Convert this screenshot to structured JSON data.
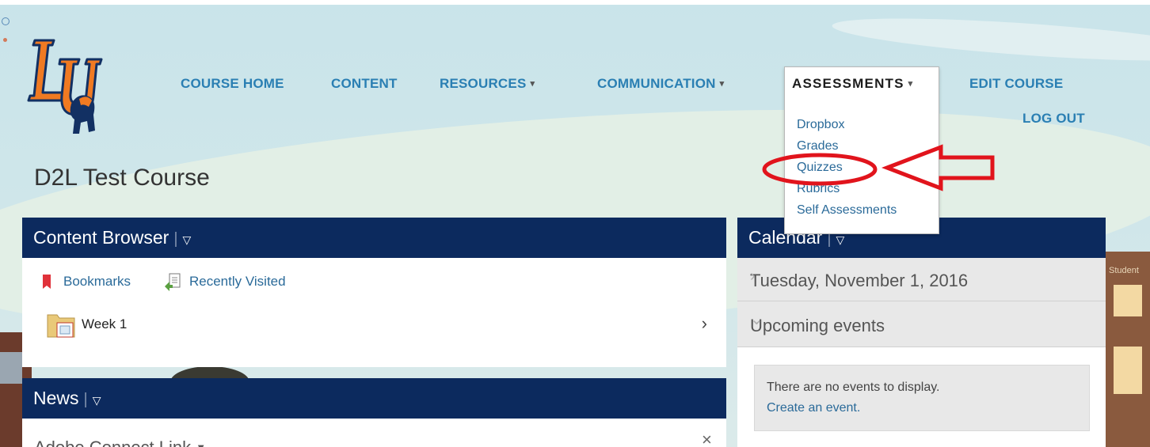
{
  "nav": {
    "course_home": "COURSE HOME",
    "content": "CONTENT",
    "resources": "RESOURCES",
    "communication": "COMMUNICATION",
    "assessments": "ASSESSMENTS",
    "edit_course": "EDIT COURSE",
    "log_out": "LOG OUT",
    "caret": "▾"
  },
  "logo": {
    "text": "LU"
  },
  "assessments_menu": {
    "title": "ASSESSMENTS",
    "items": [
      "Dropbox",
      "Grades",
      "Quizzes",
      "Rubrics",
      "Self Assessments"
    ],
    "highlighted": "Quizzes",
    "highlight_color": "#e1141c"
  },
  "course": {
    "title": "D2L Test Course"
  },
  "content_browser": {
    "title": "Content Browser",
    "menu_icon": "▽",
    "bookmarks": "Bookmarks",
    "recently_visited": "Recently Visited",
    "modules": [
      {
        "name": "Week 1"
      }
    ]
  },
  "news": {
    "title": "News",
    "menu_icon": "▽",
    "item_title": "Adobe Connect Link",
    "close": "×"
  },
  "calendar": {
    "title": "Calendar",
    "menu_icon": "▽",
    "date": "Tuesday, November 1, 2016",
    "upcoming": "Upcoming events",
    "no_events": "There are no events to display.",
    "create_event": "Create an event."
  },
  "background_sign": "Student",
  "colors": {
    "panel_header": "#0c2a5e",
    "link": "#2a7fb3",
    "annotation": "#e1141c"
  }
}
